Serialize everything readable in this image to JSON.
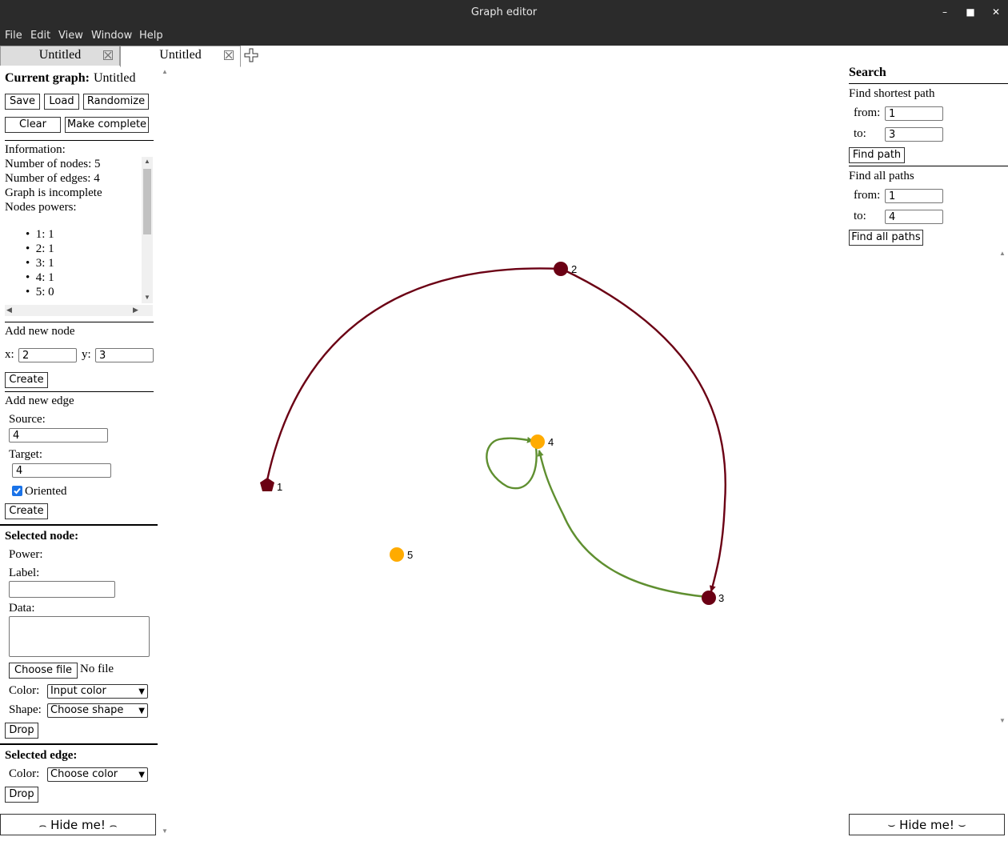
{
  "window": {
    "title": "Graph editor"
  },
  "menu": [
    "File",
    "Edit",
    "View",
    "Window",
    "Help"
  ],
  "tabs": [
    {
      "label": "Untitled"
    },
    {
      "label": "Untitled"
    }
  ],
  "left_panel": {
    "current_graph_label": "Current graph:",
    "current_graph_name": "Untitled",
    "buttons": {
      "save": "Save",
      "load": "Load",
      "randomize": "Randomize",
      "clear": "Clear",
      "make_complete": "Make complete"
    },
    "info": {
      "heading": "Information:",
      "nodes_line": "Number of nodes: 5",
      "edges_line": "Number of edges: 4",
      "complete_line": "Graph is incomplete",
      "powers_heading": "Nodes powers:",
      "powers": [
        "1: 1",
        "2: 1",
        "3: 1",
        "4: 1",
        "5: 0"
      ]
    },
    "add_node": {
      "heading": "Add new node",
      "x_label": "x:",
      "x_value": "2",
      "y_label": "y:",
      "y_value": "3",
      "create": "Create"
    },
    "add_edge": {
      "heading": "Add new edge",
      "source_label": "Source:",
      "source_value": "4",
      "target_label": "Target:",
      "target_value": "4",
      "oriented_label": "Oriented",
      "oriented_checked": true,
      "create": "Create"
    },
    "selected_node": {
      "heading": "Selected node:",
      "power_label": "Power:",
      "label_label": "Label:",
      "label_value": "",
      "data_label": "Data:",
      "choose_file": "Choose file",
      "no_file": "No file",
      "color_label": "Color:",
      "color_value": "Input color",
      "shape_label": "Shape:",
      "shape_value": "Choose shape",
      "drop": "Drop"
    },
    "selected_edge": {
      "heading": "Selected edge:",
      "color_label": "Color:",
      "color_value": "Choose color",
      "drop": "Drop"
    },
    "hide": "⌢ Hide me! ⌢"
  },
  "graph": {
    "colors": {
      "dark": "#6b0014",
      "orange": "#ffab00",
      "green": "#5f8f30"
    },
    "nodes": [
      {
        "id": "1",
        "shape": "pentagon",
        "color": "dark"
      },
      {
        "id": "2",
        "shape": "circle",
        "color": "dark"
      },
      {
        "id": "3",
        "shape": "circle",
        "color": "dark"
      },
      {
        "id": "4",
        "shape": "circle",
        "color": "orange"
      },
      {
        "id": "5",
        "shape": "circle",
        "color": "orange"
      }
    ],
    "edges": [
      {
        "source": "1",
        "target": "2",
        "color": "dark",
        "oriented": false
      },
      {
        "source": "2",
        "target": "3",
        "color": "dark",
        "oriented": true
      },
      {
        "source": "3",
        "target": "4",
        "color": "green",
        "oriented": true
      },
      {
        "source": "4",
        "target": "4",
        "color": "green",
        "oriented": true
      }
    ]
  },
  "search": {
    "heading": "Search",
    "shortest": {
      "heading": "Find shortest path",
      "from_label": "from:",
      "from_value": "1",
      "to_label": "to:",
      "to_value": "3",
      "button": "Find path"
    },
    "all": {
      "heading": "Find all paths",
      "from_label": "from:",
      "from_value": "1",
      "to_label": "to:",
      "to_value": "4",
      "button": "Find all paths"
    },
    "hide": "⌣ Hide me! ⌣"
  }
}
